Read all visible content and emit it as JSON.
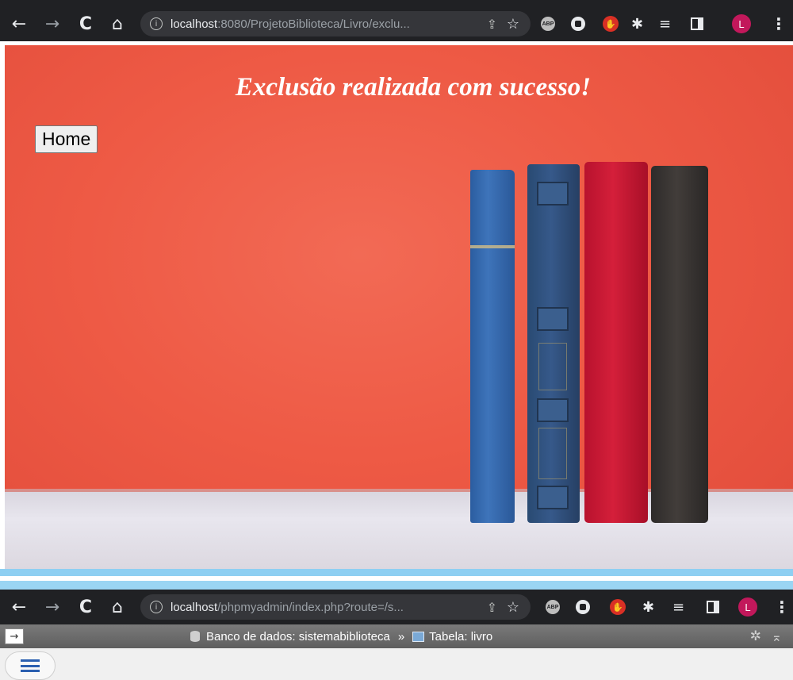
{
  "browser_top": {
    "url_host": "localhost",
    "url_rest": ":8080/ProjetoBiblioteca/Livro/exclu...",
    "avatar_letter": "L"
  },
  "page": {
    "message": "Exclusão realizada com sucesso!",
    "home_button": "Home"
  },
  "browser_bottom": {
    "url_host": "localhost",
    "url_rest": "/phpmyadmin/index.php?route=/s...",
    "avatar_letter": "L"
  },
  "phpmyadmin": {
    "arrow": "→",
    "database_crumb": "Banco de dados: sistemabiblioteca",
    "separator": "»",
    "table_crumb": "Tabela: livro"
  },
  "icons": {
    "back": "back-arrow-icon",
    "forward": "forward-arrow-icon",
    "reload": "reload-icon",
    "home": "home-icon",
    "info": "site-info-icon",
    "share": "share-icon",
    "bookmark": "star-icon",
    "adblock": "adblock-extension-icon",
    "record": "record-extension-icon",
    "stop": "stop-extension-icon",
    "extensions": "puzzle-icon",
    "media": "media-queue-icon",
    "side_panel": "side-panel-icon",
    "menu": "kebab-menu-icon"
  },
  "colors": {
    "wall": "#ee5a45",
    "chrome": "#202124",
    "avatar": "#c2185b",
    "divider": "#8ecff2"
  }
}
